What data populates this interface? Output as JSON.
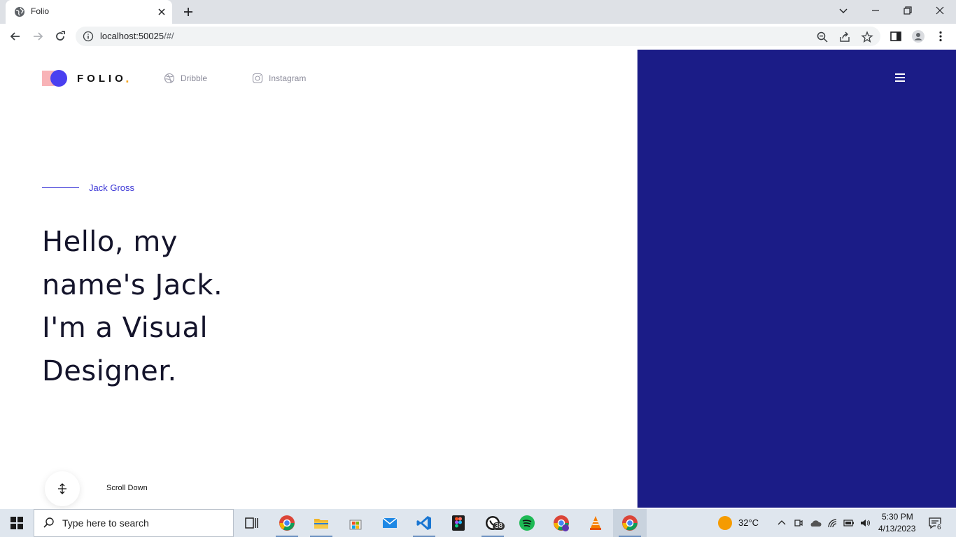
{
  "browser": {
    "tab_title": "Folio",
    "url_host": "localhost:50025",
    "url_path": "/#/"
  },
  "site": {
    "logo_text": "FOLIO",
    "logo_dot": ".",
    "social": [
      {
        "label": "Dribble",
        "icon": "dribbble-icon"
      },
      {
        "label": "Instagram",
        "icon": "instagram-icon"
      }
    ],
    "role_name": "Jack Gross",
    "headline": [
      "Hello, my",
      "name's Jack.",
      "I'm a Visual",
      "Designer."
    ],
    "scroll_label": "Scroll Down",
    "colors": {
      "accent": "#3b36d6",
      "panel": "#1b1c87",
      "logo_pink": "#f8b3b7",
      "logo_blue": "#4a3ff0",
      "logo_dot": "#f5a623"
    }
  },
  "taskbar": {
    "search_placeholder": "Type here to search",
    "whatsapp_badge": "38",
    "weather_temp": "32°C",
    "time": "5:30 PM",
    "date": "4/13/2023",
    "notification_count": "6"
  }
}
